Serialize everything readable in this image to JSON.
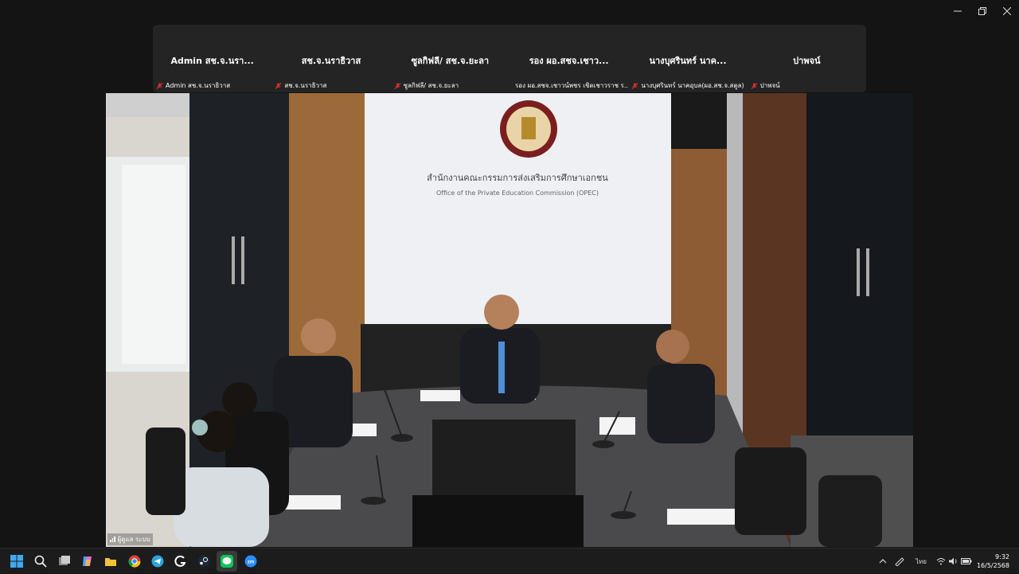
{
  "participants": [
    {
      "display_name": "Admin สช.จ.นรา...",
      "label": "Admin สช.จ.นราธิวาส"
    },
    {
      "display_name": "สช.จ.นราธิวาส",
      "label": "สช.จ.นราธิวาส"
    },
    {
      "display_name": "ซูลกิฟลี/ สช.จ.ยะลา",
      "label": "ซูลกิฟลี/ สช.จ.ยะลา"
    },
    {
      "display_name": "รอง ผอ.สชจ.เชาว...",
      "label": "รอง ผอ.สชจ.เชาวน์พชร เชิดเชาวราช ร..."
    },
    {
      "display_name": "นางบุศรินทร์ นาค...",
      "label": "นางบุศรินทร์ นาคอุบล(ผอ.สช.จ.สตูล)"
    },
    {
      "display_name": "ปาพจน์",
      "label": "ปาพจน์"
    }
  ],
  "active_speaker": {
    "label": "ผู้ดูแล ระบบ",
    "sign_thai": "สำนักงานคณะกรรมการส่งเสริมการศึกษาเอกชน",
    "sign_english": "Office of the Private Education Commission (OPEC)"
  },
  "taskbar": {
    "apps": [
      "windows-start",
      "search",
      "task-view",
      "copilot",
      "file-explorer",
      "chrome",
      "telegram",
      "g-app",
      "steam",
      "line",
      "zoom"
    ],
    "active_app": "line",
    "input_language": "ไทย",
    "time": "9:32",
    "date": "16/5/2568"
  },
  "colors": {
    "gallery_bg": "#242424",
    "mic_muted": "#e02f2f",
    "taskbar_bg": "#1c1c1c"
  }
}
